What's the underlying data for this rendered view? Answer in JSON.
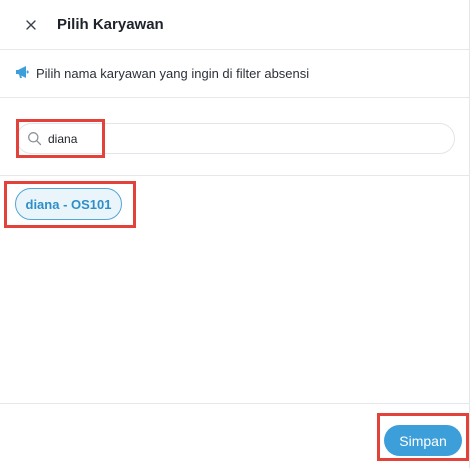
{
  "dialog": {
    "title": "Pilih Karyawan",
    "close_icon": "close-icon"
  },
  "info": {
    "icon": "megaphone-icon",
    "text": "Pilih nama karyawan yang ingin di filter absensi"
  },
  "search": {
    "icon": "search-icon",
    "value": "diana",
    "placeholder": ""
  },
  "results": [
    {
      "label": "diana - OS101"
    }
  ],
  "footer": {
    "save_label": "Simpan"
  },
  "colors": {
    "accent": "#3d9fd9",
    "chip_border": "#53a6d6",
    "chip_bg": "#eaf5fb",
    "highlight": "#e2423a"
  }
}
